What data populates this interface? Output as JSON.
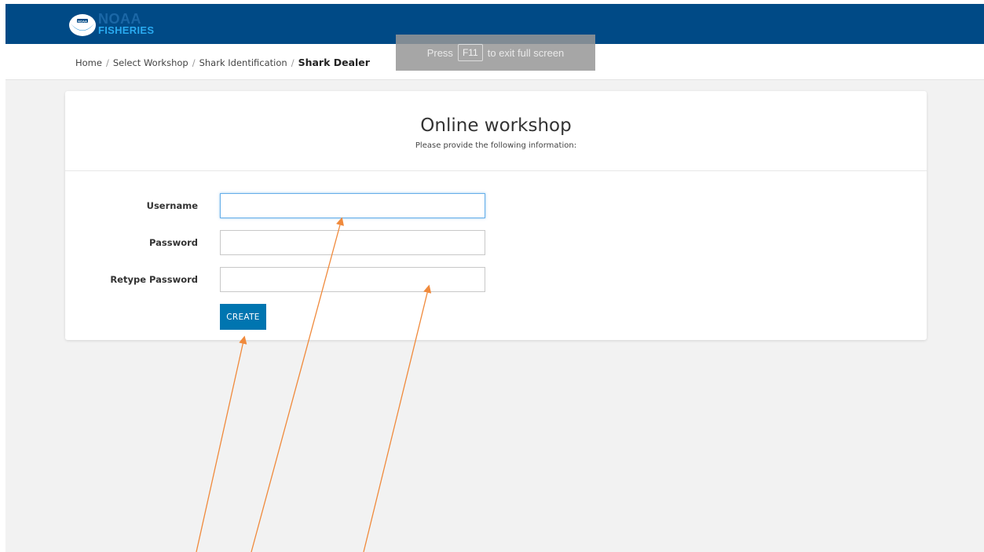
{
  "header": {
    "logo_word1": "NOAA",
    "logo_word2": "FISHERIES",
    "logo_badge": "NOAA"
  },
  "breadcrumb": {
    "items": [
      "Home",
      "Select Workshop",
      "Shark Identification"
    ],
    "current": "Shark Dealer",
    "separator": "/"
  },
  "toast": {
    "prefix": "Press",
    "key": "F11",
    "suffix": "to exit full screen"
  },
  "form": {
    "title": "Online workshop",
    "subtitle": "Please provide the following information:",
    "fields": [
      {
        "label": "Username",
        "value": ""
      },
      {
        "label": "Password",
        "value": ""
      },
      {
        "label": "Retype Password",
        "value": ""
      }
    ],
    "submit_label": "CREATE"
  },
  "colors": {
    "header_bg": "#004a86",
    "button_bg": "#0075b0",
    "annotation_arrow": "#f08a3c"
  }
}
